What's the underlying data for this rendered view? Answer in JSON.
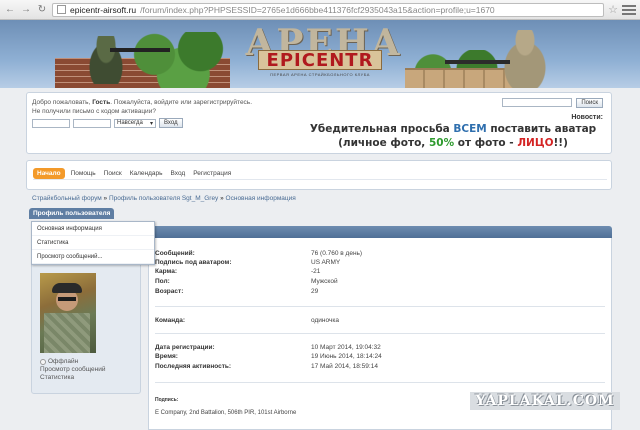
{
  "browser": {
    "url_host": "epicentr-airsoft.ru",
    "url_rest": "/forum/index.php?PHPSESSID=2765e1d666bbe411376fcf2935043a15&action=profile;u=1670"
  },
  "banner": {
    "logo_top": "АРЕНА",
    "logo_main": "EPICENTR",
    "logo_sub": "ПЕРВАЯ АРЕНА СТРАЙКБОЛЬНОГО КЛУБА"
  },
  "header": {
    "welcome_line1_prefix": "Добро пожаловать, ",
    "welcome_guest": "Гость",
    "welcome_line1_suffix": ". Пожалуйста, войдите или зарегистрируйтесь.",
    "welcome_line2": "Не получили письмо с кодом активации?",
    "session_select": "Навсегда",
    "login_button": "Вход",
    "search_button": "Поиск",
    "news_title": "Новости:",
    "news_part1": "Убедительная просьба ",
    "news_em": "ВСЕМ",
    "news_part2": " поставить аватар",
    "news_part3": "(личное фото, ",
    "news_percent": "50%",
    "news_part4": " от фото - ",
    "news_face": "ЛИЦО",
    "news_part5": "!!)"
  },
  "menu": {
    "items": [
      {
        "label": "Начало"
      },
      {
        "label": "Помощь"
      },
      {
        "label": "Поиск"
      },
      {
        "label": "Календарь"
      },
      {
        "label": "Вход"
      },
      {
        "label": "Регистрация"
      }
    ]
  },
  "breadcrumb": {
    "part1": "Страйкбольный форум",
    "part2": "Профиль пользователя Sgt_M_Grey",
    "part3": "Основная информация",
    "sep": " » "
  },
  "profile_tab": "Профиль пользователя",
  "dropdown": {
    "items": [
      {
        "label": "Основная информация"
      },
      {
        "label": "Статистика"
      },
      {
        "label": "Просмотр сообщений..."
      }
    ]
  },
  "leftcol": {
    "status": "Оффлайн",
    "link1": "Просмотр сообщений",
    "link2": "Статистика"
  },
  "profile": {
    "posts_k": "Сообщений:",
    "posts_v": "76 (0.760 в день)",
    "avatar_caption_k": "Подпись под аватаром:",
    "avatar_caption_v": "US ARMY",
    "karma_k": "Карма:",
    "karma_v": "-21",
    "gender_k": "Пол:",
    "gender_v": "Мужской",
    "age_k": "Возраст:",
    "age_v": "29",
    "team_k": "Команда:",
    "team_v": "одиночка",
    "reg_k": "Дата регистрации:",
    "reg_v": "10 Март 2014, 19:04:32",
    "time_k": "Время:",
    "time_v": "19 Июнь 2014, 18:14:24",
    "last_k": "Последняя активность:",
    "last_v": "17 Май 2014, 18:59:14",
    "sig_label": "Подпись:",
    "sig_text": "E Company, 2nd Battalion, 506th PIR, 101st Airborne"
  },
  "watermark": "YAPLAKAL.COM"
}
